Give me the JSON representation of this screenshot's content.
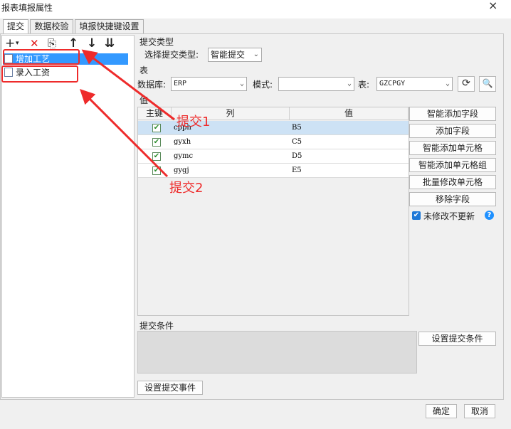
{
  "window": {
    "title": "报表填报属性",
    "close_glyph": "×"
  },
  "tabs": [
    {
      "label": "提交",
      "active": true
    },
    {
      "label": "数据校验",
      "active": false
    },
    {
      "label": "填报快捷键设置",
      "active": false
    }
  ],
  "toolbar": {
    "add": "+",
    "add_dropdown": "▾",
    "delete": "✕",
    "copy": "⎘",
    "up": "↑",
    "down": "↓",
    "move_end": "⇊"
  },
  "tree": [
    {
      "label": "增加工艺",
      "selected": true
    },
    {
      "label": "录入工资",
      "selected": false
    }
  ],
  "submit_type": {
    "section": "提交类型",
    "label": "选择提交类型:",
    "value": "智能提交"
  },
  "table_section": {
    "section": "表",
    "database_label": "数据库:",
    "database_value": "ERP",
    "mode_label": "模式:",
    "mode_value": "",
    "table_label": "表:",
    "table_value": "GZCPGY"
  },
  "value_section": {
    "section": "值",
    "columns": [
      "主键",
      "列",
      "值"
    ],
    "rows": [
      {
        "key": true,
        "column": "cpph",
        "value": "B5",
        "selected": true
      },
      {
        "key": true,
        "column": "gyxh",
        "value": "C5",
        "selected": false
      },
      {
        "key": true,
        "column": "gymc",
        "value": "D5",
        "selected": false
      },
      {
        "key": true,
        "column": "gygj",
        "value": "E5",
        "selected": false
      }
    ]
  },
  "side_buttons": [
    "智能添加字段",
    "添加字段",
    "智能添加单元格",
    "智能添加单元格组",
    "批量修改单元格",
    "移除字段"
  ],
  "no_update_unmodified": {
    "label": "未修改不更新",
    "checked": true
  },
  "help_glyph": "?",
  "submit_condition": {
    "section": "提交条件",
    "button": "设置提交条件"
  },
  "submit_event_button": "设置提交事件",
  "footer": {
    "ok": "确定",
    "cancel": "取消"
  },
  "annotations": {
    "label1": "提交1",
    "label2": "提交2"
  },
  "colors": {
    "selection": "#3399ff",
    "annotation": "#ee2b2b",
    "help": "#1e90ff"
  }
}
